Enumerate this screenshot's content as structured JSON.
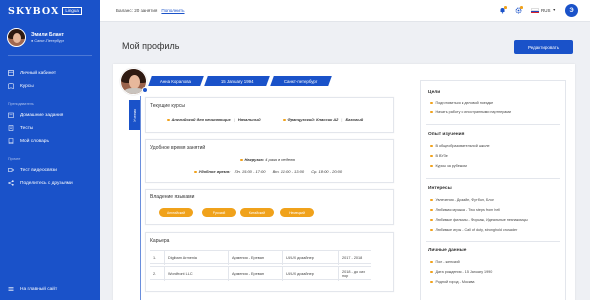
{
  "app": {
    "logo": "SKYBOX",
    "logo_badge": "Lingua"
  },
  "sidebar": {
    "user_name": "Эмили Блант",
    "user_city": "● Санкт-Петербург",
    "items_main": [
      {
        "label": "Личный кабинет",
        "icon": "dashboard-icon"
      },
      {
        "label": "Курсы",
        "icon": "courses-icon"
      }
    ],
    "section_education": "Преподаватель",
    "items_education": [
      {
        "label": "Домашние задания",
        "icon": "homework-icon"
      },
      {
        "label": "Тесты",
        "icon": "tests-icon"
      },
      {
        "label": "Мой словарь",
        "icon": "dictionary-icon"
      }
    ],
    "section_other": "Прочее",
    "items_other": [
      {
        "label": "Тест видеосвязи",
        "icon": "video-icon"
      },
      {
        "label": "Поделитесь с друзьями",
        "icon": "share-icon"
      }
    ],
    "bottom_link": "На главный сайт"
  },
  "topbar": {
    "balance": "Баланс: 20 занятия",
    "topup": "Пополнить",
    "language": "RUS",
    "user_initial": "Э"
  },
  "page": {
    "title": "Мой профиль",
    "edit_button": "Редактировать"
  },
  "profile": {
    "name": "Анна Коралова",
    "birthdate": "15 January 1994",
    "city": "Санкт-петербург",
    "status_tab": "Ученик"
  },
  "courses": {
    "title": "Текущие курсы",
    "items": [
      {
        "name": "Английский для начинающих",
        "level": "Начальный"
      },
      {
        "name": "Французский: Классик А2",
        "level": "Базовый"
      }
    ]
  },
  "schedule": {
    "title": "Удобное время занятий",
    "load_label": "Нагрузка:",
    "load_value": "4 раза в неделю",
    "times_label": "Удобное время:",
    "slots": [
      "Пн. 15:00 - 17:00",
      "Вт. 11:00 - 13:00",
      "Ср. 18:00 - 20:00"
    ]
  },
  "languages": {
    "title": "Владение языками",
    "pills": [
      "Английский",
      "Русский",
      "Китайский",
      "Немецкий"
    ]
  },
  "career": {
    "title": "Карьера",
    "rows": [
      {
        "n": "1.",
        "company": "Digibam Armenia",
        "place": "Армения - Ереван",
        "role": "UI/UX дизайнер",
        "years": "2017 - 2018"
      },
      {
        "n": "2.",
        "company": "Wordfront LLC",
        "place": "Армения - Ереван",
        "role": "UI/UX дизайнер",
        "years": "2018 - до сих пор"
      }
    ]
  },
  "goals": {
    "title": "Цели",
    "items": [
      "Подготовиться к деловой поездке",
      "Начать работу с иностранными партнерами"
    ]
  },
  "experience": {
    "title": "Опыт изучения",
    "items": [
      "В общеобразовательной школе",
      "В ВУЗе",
      "Курсы за рубежом"
    ]
  },
  "interests": {
    "title": "Интересы",
    "items": [
      "Увлечения - Дизайн, Футбол, Блог",
      "Любимая музыка - Two steps from hell",
      "Любимые фильмы - Форсаж, Идеальные незнакомцы",
      "Любимые игры - Call of duty, stronghold crusader"
    ]
  },
  "personal": {
    "title": "Личные данные",
    "items": [
      "Пол - женский",
      "Дата рождения - 15 January 1990",
      "Родной город - Москва"
    ]
  },
  "colors": {
    "primary": "#1a52c9",
    "accent": "#f0a21b",
    "background": "#eef0f4"
  }
}
